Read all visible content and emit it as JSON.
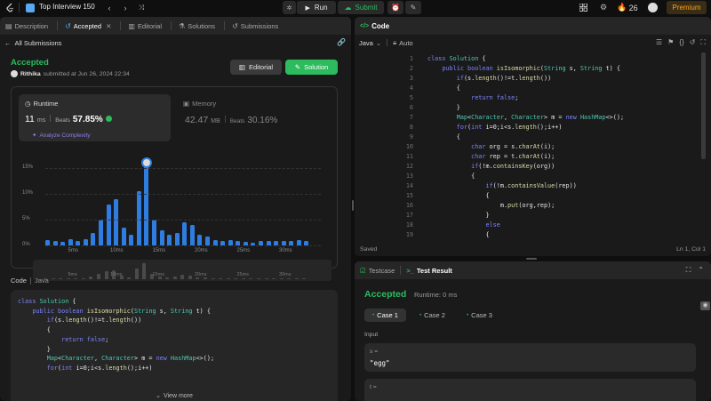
{
  "topbar": {
    "problem_list": "Top Interview 150",
    "run": "Run",
    "submit": "Submit",
    "streak": "26",
    "premium": "Premium"
  },
  "left_tabs": [
    {
      "label": "Description"
    },
    {
      "label": "Accepted"
    },
    {
      "label": "Editorial"
    },
    {
      "label": "Solutions"
    },
    {
      "label": "Submissions"
    }
  ],
  "submission": {
    "back": "All Submissions",
    "status": "Accepted",
    "user": "Rithika",
    "submitted": "submitted at Jun 26, 2024 22:34",
    "editorial_btn": "Editorial",
    "solution_btn": "Solution"
  },
  "runtime": {
    "label": "Runtime",
    "value": "11",
    "unit": "ms",
    "beats_label": "Beats",
    "beats": "57.85%",
    "analyze": "Analyze Complexity"
  },
  "memory": {
    "label": "Memory",
    "value": "42.47",
    "unit": "MB",
    "beats_label": "Beats",
    "beats": "30.16%"
  },
  "chart_data": {
    "type": "bar",
    "y_ticks": [
      "15%",
      "10%",
      "5%",
      "0%"
    ],
    "x_ticks": [
      "5ms",
      "10ms",
      "15ms",
      "20ms",
      "25ms",
      "30ms"
    ],
    "ylim": [
      0,
      15
    ],
    "values": [
      1,
      0.8,
      0.7,
      1.2,
      0.8,
      1.2,
      2.5,
      5,
      8,
      9,
      3.5,
      2,
      10.5,
      16,
      5,
      3,
      2,
      2.5,
      4.5,
      4,
      2,
      1.8,
      1,
      0.8,
      1,
      0.8,
      0.7,
      0.5,
      0.8,
      0.8,
      0.8,
      0.8,
      0.8,
      1,
      0.8
    ],
    "highlight_index": 13,
    "mini_values": [
      0.5,
      0.4,
      0.4,
      0.6,
      0.4,
      0.6,
      1.2,
      2.5,
      4,
      4.5,
      1.8,
      1,
      5.2,
      8,
      2.5,
      1.5,
      1,
      1.2,
      2.2,
      2,
      1,
      0.9,
      0.5,
      0.4,
      0.5,
      0.4,
      0.35,
      0.25,
      0.4,
      0.4,
      0.4,
      0.4,
      0.4,
      0.5,
      0.4
    ]
  },
  "left_code": {
    "header_code": "Code",
    "header_lang": "Java",
    "view_more": "View more",
    "lines": [
      "class Solution {",
      "    public boolean isIsomorphic(String s, String t) {",
      "        if(s.length()!=t.length())",
      "        {",
      "            return false;",
      "        }",
      "        Map<Character, Character> m = new HashMap<>();",
      "        for(int i=0;i<s.length();i++)"
    ]
  },
  "editor": {
    "title": "Code",
    "lang": "Java",
    "auto": "Auto",
    "status": "Saved",
    "cursor": "Ln 1, Col 1",
    "lines": [
      {
        "n": "1",
        "t": "class Solution {"
      },
      {
        "n": "2",
        "t": "    public boolean isIsomorphic(String s, String t) {"
      },
      {
        "n": "3",
        "t": "        if(s.length()!=t.length())"
      },
      {
        "n": "4",
        "t": "        {"
      },
      {
        "n": "5",
        "t": "            return false;"
      },
      {
        "n": "6",
        "t": "        }"
      },
      {
        "n": "7",
        "t": "        Map<Character, Character> m = new HashMap<>();"
      },
      {
        "n": "8",
        "t": "        for(int i=0;i<s.length();i++)"
      },
      {
        "n": "9",
        "t": "        {"
      },
      {
        "n": "10",
        "t": "            char org = s.charAt(i);"
      },
      {
        "n": "11",
        "t": "            char rep = t.charAt(i);"
      },
      {
        "n": "12",
        "t": "            if(!m.containsKey(org))"
      },
      {
        "n": "13",
        "t": "            {"
      },
      {
        "n": "14",
        "t": "                if(!m.containsValue(rep))"
      },
      {
        "n": "15",
        "t": "                {"
      },
      {
        "n": "16",
        "t": "                    m.put(org,rep);"
      },
      {
        "n": "17",
        "t": "                }"
      },
      {
        "n": "18",
        "t": "                else"
      },
      {
        "n": "19",
        "t": "                {"
      }
    ]
  },
  "result": {
    "tab_testcase": "Testcase",
    "tab_result": "Test Result",
    "status": "Accepted",
    "runtime": "Runtime: 0 ms",
    "cases": [
      "Case 1",
      "Case 2",
      "Case 3"
    ],
    "input_label": "Input",
    "var1": "s =",
    "val1": "\"egg\"",
    "var2": "t ="
  },
  "colors": {
    "accent_green": "#2cbb5d",
    "blue": "#2f7de1",
    "orange": "#ffa116"
  }
}
